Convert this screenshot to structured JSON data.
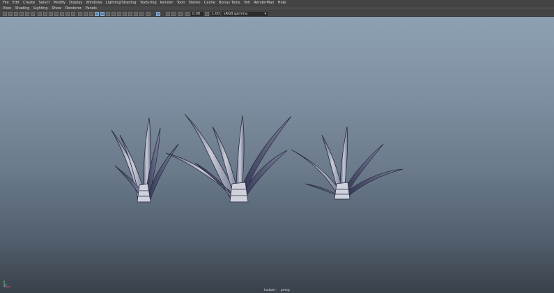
{
  "menu_bar": [
    "File",
    "Edit",
    "Create",
    "Select",
    "Modify",
    "Display",
    "Windows",
    "Lighting/Shading",
    "Texturing",
    "Render",
    "Toon",
    "Stereo",
    "Cache",
    "Bonus Tools",
    "Yeti",
    "RenderMan",
    "Help"
  ],
  "panel_menu": [
    "View",
    "Shading",
    "Lighting",
    "Show",
    "Renderer",
    "Panels"
  ],
  "toolbar": {
    "exposure_value": "0.00",
    "gamma_value": "1.00",
    "color_management": "sRGB gamma"
  },
  "hud": {
    "isolate_label": "Isolate :",
    "camera_label": "persp"
  },
  "icons": [
    "camera-icon",
    "grid-icon",
    "wireframe-icon",
    "smooth-shade-icon",
    "texture-icon",
    "light-icon",
    "isolate-icon",
    "exposure-icon",
    "gamma-icon",
    "axis-icon"
  ],
  "colors": {
    "viewport_top": "#8ea0b3",
    "viewport_bottom": "#39414a",
    "active_tool": "#5a7fa8"
  }
}
